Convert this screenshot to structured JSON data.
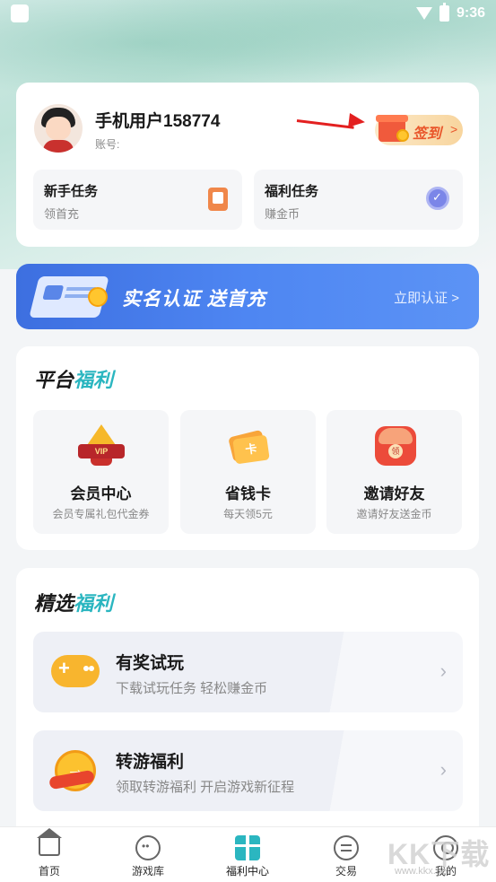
{
  "status_bar": {
    "time": "9:36"
  },
  "user": {
    "name": "手机用户158774",
    "account_label": "账号:",
    "signin_label": "签到",
    "signin_chevron": ">"
  },
  "tasks": [
    {
      "title": "新手任务",
      "subtitle": "领首充",
      "icon": "phone-task-icon"
    },
    {
      "title": "福利任务",
      "subtitle": "赚金币",
      "icon": "medal-icon"
    }
  ],
  "banner": {
    "title": "实名认证  送首充",
    "cta": "立即认证 >"
  },
  "platform_welfare": {
    "title_main": "平台",
    "title_accent": "福利",
    "items": [
      {
        "name": "会员中心",
        "desc": "会员专属礼包代金券",
        "badge": "VIP"
      },
      {
        "name": "省钱卡",
        "desc": "每天领5元",
        "badge": "卡"
      },
      {
        "name": "邀请好友",
        "desc": "邀请好友送金币",
        "badge": "领"
      }
    ]
  },
  "selected_welfare": {
    "title_main": "精选",
    "title_accent": "福利",
    "items": [
      {
        "title": "有奖试玩",
        "subtitle": "下载试玩任务 轻松赚金币",
        "chevron": "›"
      },
      {
        "title": "转游福利",
        "subtitle": "领取转游福利 开启游戏新征程",
        "chevron": "›"
      }
    ]
  },
  "bottom_nav": {
    "items": [
      {
        "label": "首页"
      },
      {
        "label": "游戏库"
      },
      {
        "label": "福利中心"
      },
      {
        "label": "交易"
      },
      {
        "label": "我的"
      }
    ],
    "active": "福利中心"
  },
  "watermark": {
    "text": "KK下载",
    "url": "www.kkx.net"
  },
  "colors": {
    "accent": "#2bb6c0",
    "banner": "#4e86f2",
    "signin": "#e9552a"
  }
}
